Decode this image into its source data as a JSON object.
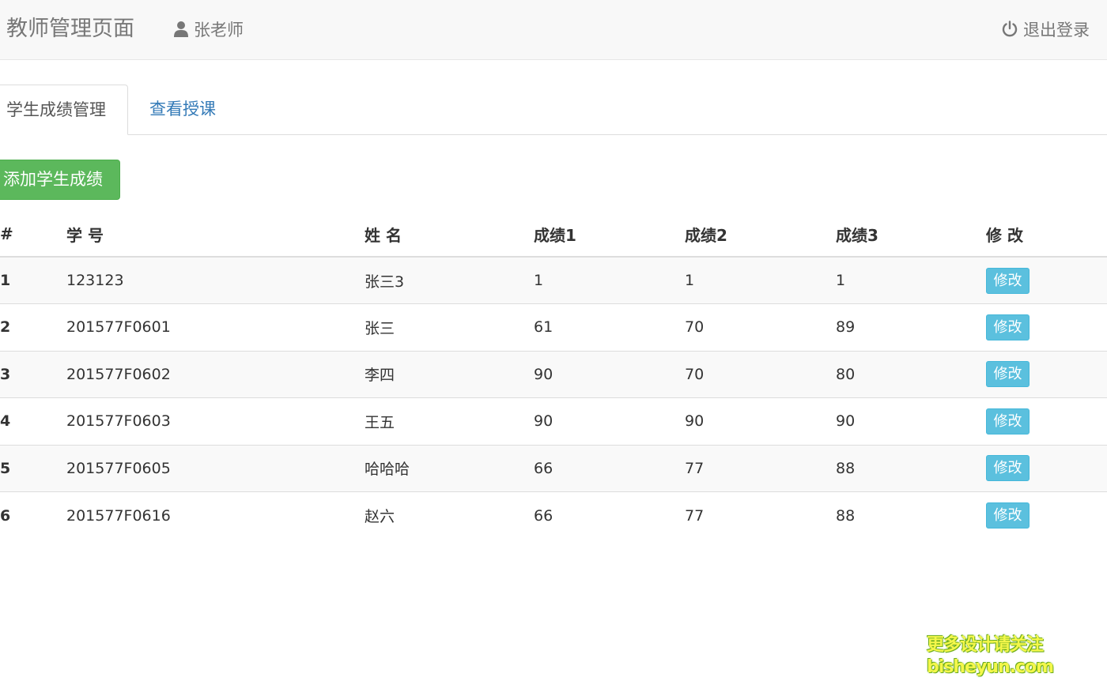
{
  "navbar": {
    "brand": "教师管理页面",
    "user_name": "张老师",
    "user_icon": "user-icon",
    "logout_label": "退出登录",
    "logout_icon": "power-icon"
  },
  "tabs": [
    {
      "label": "学生成绩管理",
      "active": true
    },
    {
      "label": "查看授课",
      "active": false
    }
  ],
  "actions": {
    "add_label": "添加学生成绩"
  },
  "table": {
    "headers": [
      "#",
      "学 号",
      "姓 名",
      "成绩1",
      "成绩2",
      "成绩3",
      "修 改"
    ],
    "edit_label": "修改",
    "rows": [
      {
        "idx": "1",
        "student_id": "123123",
        "name": "张三3",
        "score1": "1",
        "score2": "1",
        "score3": "1"
      },
      {
        "idx": "2",
        "student_id": "201577F0601",
        "name": "张三",
        "score1": "61",
        "score2": "70",
        "score3": "89"
      },
      {
        "idx": "3",
        "student_id": "201577F0602",
        "name": "李四",
        "score1": "90",
        "score2": "70",
        "score3": "80"
      },
      {
        "idx": "4",
        "student_id": "201577F0603",
        "name": "王五",
        "score1": "90",
        "score2": "90",
        "score3": "90"
      },
      {
        "idx": "5",
        "student_id": "201577F0605",
        "name": "哈哈哈",
        "score1": "66",
        "score2": "77",
        "score3": "88"
      },
      {
        "idx": "6",
        "student_id": "201577F0616",
        "name": "赵六",
        "score1": "66",
        "score2": "77",
        "score3": "88"
      }
    ]
  },
  "watermark": {
    "line1": "更多设计请关注",
    "line2": "bisheyun.com"
  },
  "colors": {
    "success": "#5cb85c",
    "info": "#5bc0de",
    "link": "#337ab7",
    "navbar_bg": "#f8f8f8"
  }
}
